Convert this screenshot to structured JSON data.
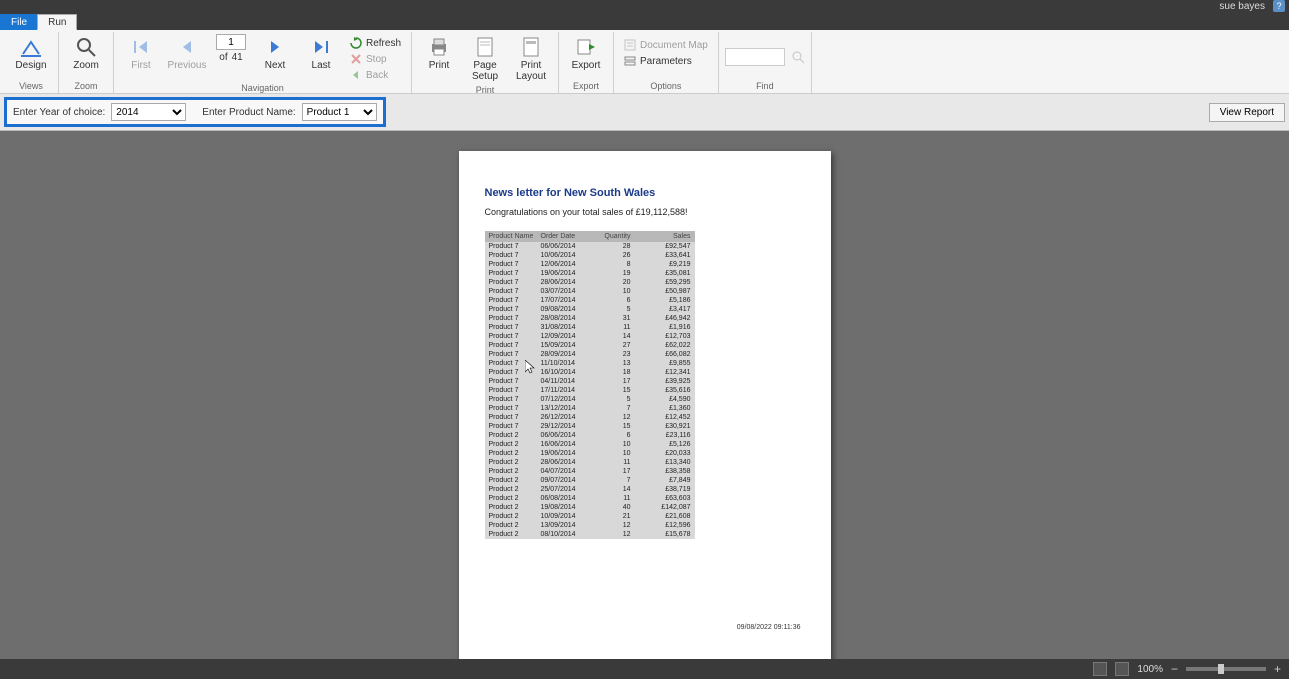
{
  "titlebar": {
    "user": "sue bayes",
    "help": "?"
  },
  "tabs": {
    "file": "File",
    "run": "Run"
  },
  "ribbon": {
    "views": {
      "design": "Design",
      "group": "Views"
    },
    "zoom": {
      "zoom": "Zoom",
      "group": "Zoom"
    },
    "navigation": {
      "first": "First",
      "previous": "Previous",
      "next": "Next",
      "last": "Last",
      "page_current": "1",
      "page_of": "of",
      "page_total": "41",
      "refresh": "Refresh",
      "stop": "Stop",
      "back": "Back",
      "group": "Navigation"
    },
    "print": {
      "print": "Print",
      "page_setup": "Page\nSetup",
      "print_layout": "Print\nLayout",
      "group": "Print"
    },
    "export": {
      "export": "Export",
      "group": "Export"
    },
    "options": {
      "document_map": "Document Map",
      "parameters": "Parameters",
      "group": "Options"
    },
    "find": {
      "group": "Find"
    }
  },
  "params": {
    "year_label": "Enter Year of choice:",
    "year_value": "2014",
    "product_label": "Enter Product Name:",
    "product_value": "Product 1",
    "view_report": "View Report"
  },
  "report": {
    "title": "News letter for New South Wales",
    "subtitle": "Congratulations on your total sales of £19,112,588!",
    "columns": {
      "c1": "Product Name",
      "c2": "Order Date",
      "c3": "Quantity",
      "c4": "Sales"
    },
    "rows": [
      {
        "p": "Product 7",
        "d": "06/06/2014",
        "q": "28",
        "s": "£92,547"
      },
      {
        "p": "Product 7",
        "d": "10/06/2014",
        "q": "26",
        "s": "£33,641"
      },
      {
        "p": "Product 7",
        "d": "12/06/2014",
        "q": "8",
        "s": "£9,219"
      },
      {
        "p": "Product 7",
        "d": "19/06/2014",
        "q": "19",
        "s": "£35,081"
      },
      {
        "p": "Product 7",
        "d": "28/06/2014",
        "q": "20",
        "s": "£59,295"
      },
      {
        "p": "Product 7",
        "d": "03/07/2014",
        "q": "10",
        "s": "£50,987"
      },
      {
        "p": "Product 7",
        "d": "17/07/2014",
        "q": "6",
        "s": "£5,186"
      },
      {
        "p": "Product 7",
        "d": "09/08/2014",
        "q": "5",
        "s": "£3,417"
      },
      {
        "p": "Product 7",
        "d": "28/08/2014",
        "q": "31",
        "s": "£46,942"
      },
      {
        "p": "Product 7",
        "d": "31/08/2014",
        "q": "11",
        "s": "£1,916"
      },
      {
        "p": "Product 7",
        "d": "12/09/2014",
        "q": "14",
        "s": "£12,703"
      },
      {
        "p": "Product 7",
        "d": "15/09/2014",
        "q": "27",
        "s": "£62,022"
      },
      {
        "p": "Product 7",
        "d": "28/09/2014",
        "q": "23",
        "s": "£66,082"
      },
      {
        "p": "Product 7",
        "d": "11/10/2014",
        "q": "13",
        "s": "£9,855"
      },
      {
        "p": "Product 7",
        "d": "16/10/2014",
        "q": "18",
        "s": "£12,341"
      },
      {
        "p": "Product 7",
        "d": "04/11/2014",
        "q": "17",
        "s": "£39,925"
      },
      {
        "p": "Product 7",
        "d": "17/11/2014",
        "q": "15",
        "s": "£35,616"
      },
      {
        "p": "Product 7",
        "d": "07/12/2014",
        "q": "5",
        "s": "£4,590"
      },
      {
        "p": "Product 7",
        "d": "13/12/2014",
        "q": "7",
        "s": "£1,360"
      },
      {
        "p": "Product 7",
        "d": "26/12/2014",
        "q": "12",
        "s": "£12,452"
      },
      {
        "p": "Product 7",
        "d": "29/12/2014",
        "q": "15",
        "s": "£30,921"
      },
      {
        "p": "Product 2",
        "d": "06/06/2014",
        "q": "6",
        "s": "£23,116"
      },
      {
        "p": "Product 2",
        "d": "16/06/2014",
        "q": "10",
        "s": "£5,126"
      },
      {
        "p": "Product 2",
        "d": "19/06/2014",
        "q": "10",
        "s": "£20,033"
      },
      {
        "p": "Product 2",
        "d": "28/06/2014",
        "q": "11",
        "s": "£13,340"
      },
      {
        "p": "Product 2",
        "d": "04/07/2014",
        "q": "17",
        "s": "£38,358"
      },
      {
        "p": "Product 2",
        "d": "09/07/2014",
        "q": "7",
        "s": "£7,849"
      },
      {
        "p": "Product 2",
        "d": "25/07/2014",
        "q": "14",
        "s": "£38,719"
      },
      {
        "p": "Product 2",
        "d": "06/08/2014",
        "q": "11",
        "s": "£63,603"
      },
      {
        "p": "Product 2",
        "d": "19/08/2014",
        "q": "40",
        "s": "£142,087"
      },
      {
        "p": "Product 2",
        "d": "10/09/2014",
        "q": "21",
        "s": "£21,608"
      },
      {
        "p": "Product 2",
        "d": "13/09/2014",
        "q": "12",
        "s": "£12,596"
      },
      {
        "p": "Product 2",
        "d": "08/10/2014",
        "q": "12",
        "s": "£15,678"
      }
    ],
    "timestamp": "09/08/2022 09:11:36"
  },
  "status": {
    "zoom_pct": "100%"
  }
}
